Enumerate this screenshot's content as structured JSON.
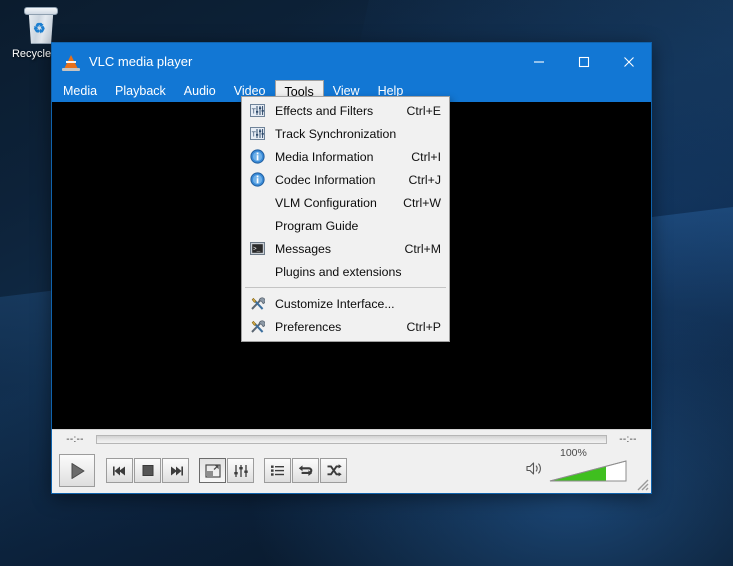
{
  "desktop": {
    "recycle_bin": {
      "label": "Recycle Bin",
      "icon": "recycle-bin-icon"
    },
    "wallpaper_colors": {
      "base": "#0d2239",
      "highlight": "#3a82cd"
    }
  },
  "window": {
    "title": "VLC media player",
    "app_icon": "vlc-cone-icon",
    "titlebar_color": "#1277d4",
    "controls": {
      "minimize": "–",
      "maximize": "□",
      "close": "✕"
    }
  },
  "menubar": {
    "items": [
      {
        "label": "Media",
        "active": false
      },
      {
        "label": "Playback",
        "active": false
      },
      {
        "label": "Audio",
        "active": false
      },
      {
        "label": "Video",
        "active": false
      },
      {
        "label": "Tools",
        "active": true
      },
      {
        "label": "View",
        "active": false
      },
      {
        "label": "Help",
        "active": false
      }
    ]
  },
  "tools_menu": {
    "open": true,
    "groups": [
      {
        "items": [
          {
            "label": "Effects and Filters",
            "shortcut": "Ctrl+E",
            "icon": "equalizer-sliders-icon"
          },
          {
            "label": "Track Synchronization",
            "shortcut": "",
            "icon": "equalizer-sliders-icon"
          },
          {
            "label": "Media Information",
            "shortcut": "Ctrl+I",
            "icon": "info-circle-icon"
          },
          {
            "label": "Codec Information",
            "shortcut": "Ctrl+J",
            "icon": "info-circle-icon"
          },
          {
            "label": "VLM Configuration",
            "shortcut": "Ctrl+W",
            "icon": "none"
          },
          {
            "label": "Program Guide",
            "shortcut": "",
            "icon": "none"
          },
          {
            "label": "Messages",
            "shortcut": "Ctrl+M",
            "icon": "console-icon"
          },
          {
            "label": "Plugins and extensions",
            "shortcut": "",
            "icon": "none"
          }
        ]
      },
      {
        "items": [
          {
            "label": "Customize Interface...",
            "shortcut": "",
            "icon": "tools-wrench-icon"
          },
          {
            "label": "Preferences",
            "shortcut": "Ctrl+P",
            "icon": "tools-wrench-icon"
          }
        ]
      }
    ]
  },
  "player": {
    "time_elapsed": "--:--",
    "time_total": "--:--",
    "seek_position_percent": 0,
    "buttons": {
      "play": "play-icon",
      "previous": "previous-track-icon",
      "stop": "stop-icon",
      "next": "next-track-icon",
      "fullscreen": "fullscreen-icon",
      "extended_settings": "equalizer-icon",
      "playlist": "playlist-icon",
      "loop": "loop-icon",
      "shuffle": "shuffle-icon"
    },
    "volume": {
      "percent_label": "100%",
      "value": 100,
      "icon": "speaker-icon",
      "fill_color": "#3fbf1f"
    },
    "resize_grip": "resize-grip-icon"
  }
}
